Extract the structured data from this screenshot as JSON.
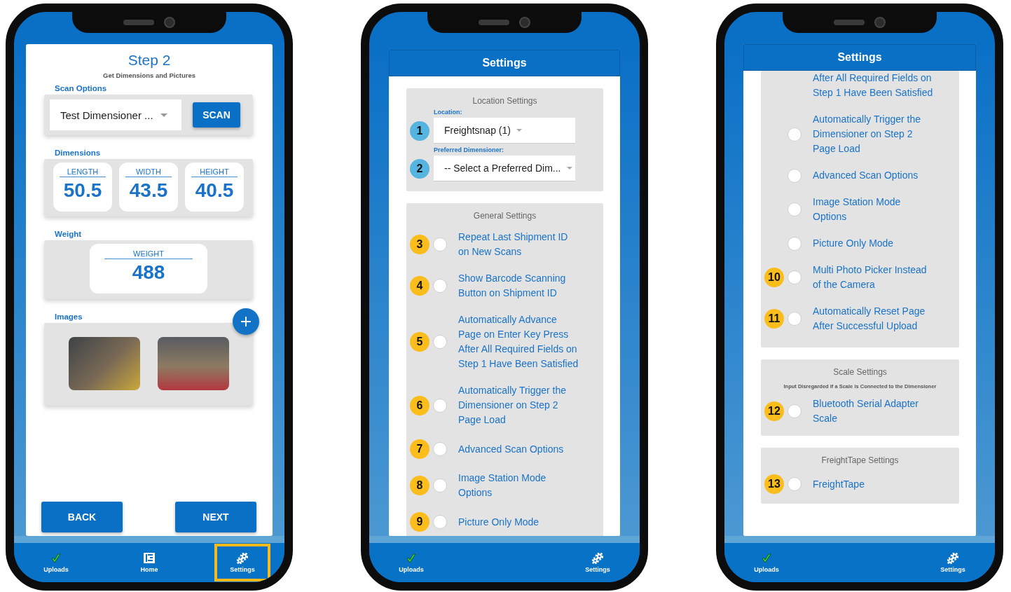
{
  "phones": [
    {
      "screen": {
        "kind": "step",
        "title": "Step 2",
        "subtitle": "Get Dimensions and Pictures",
        "scan_options": {
          "label": "Scan Options",
          "dropdown_value": "Test Dimensioner ...",
          "button": "SCAN"
        },
        "dimensions": {
          "label": "Dimensions",
          "fields": [
            {
              "label": "LENGTH",
              "value": "50.5"
            },
            {
              "label": "WIDTH",
              "value": "43.5"
            },
            {
              "label": "HEIGHT",
              "value": "40.5"
            }
          ]
        },
        "weight": {
          "label": "Weight",
          "field": {
            "label": "WEIGHT",
            "value": "488"
          }
        },
        "images": {
          "label": "Images",
          "photos": [
            {
              "kind": "photo"
            },
            {
              "kind": "photo"
            }
          ]
        },
        "buttons": [
          "BACK",
          "NEXT"
        ]
      },
      "nav": [
        {
          "kind": "uploads",
          "label": "Uploads",
          "highlighted": false
        },
        {
          "kind": "home",
          "label": "Home",
          "highlighted": false
        },
        {
          "kind": "settings",
          "label": "Settings",
          "highlighted": true
        }
      ]
    },
    {
      "screen": {
        "kind": "settings",
        "title": "Settings",
        "scrolled": false,
        "sections": [
          {
            "kind": "location",
            "heading": "Location Settings",
            "fields": [
              {
                "label": "Location:",
                "value": "Freightsnap (1)",
                "badge": {
                  "number": "1",
                  "color": "#56b4e0"
                }
              },
              {
                "label": "Preferred Dimensioner:",
                "value": "-- Select a Preferred Dim...",
                "badge": {
                  "number": "2",
                  "color": "#56b4e0"
                }
              }
            ]
          },
          {
            "kind": "toggles",
            "heading": "General Settings",
            "items": [
              {
                "text": "Repeat Last Shipment ID on New Scans",
                "checked": false,
                "badge": {
                  "number": "3",
                  "color": "#fbbd1c"
                }
              },
              {
                "text": "Show Barcode Scanning Button on Shipment ID",
                "checked": false,
                "badge": {
                  "number": "4",
                  "color": "#fbbd1c"
                }
              },
              {
                "text": "Automatically Advance Page on Enter Key Press After All Required Fields on Step 1 Have Been Satisfied",
                "checked": false,
                "badge": {
                  "number": "5",
                  "color": "#fbbd1c"
                }
              },
              {
                "text": "Automatically Trigger the Dimensioner on Step 2 Page Load",
                "checked": false,
                "badge": {
                  "number": "6",
                  "color": "#fbbd1c"
                }
              },
              {
                "text": "Advanced Scan Options",
                "checked": false,
                "badge": {
                  "number": "7",
                  "color": "#fbbd1c"
                }
              },
              {
                "text": "Image Station Mode Options",
                "checked": false,
                "badge": {
                  "number": "8",
                  "color": "#fbbd1c"
                }
              },
              {
                "text": "Picture Only Mode",
                "checked": false,
                "badge": {
                  "number": "9",
                  "color": "#fbbd1c"
                }
              }
            ]
          }
        ]
      },
      "nav": [
        {
          "kind": "uploads",
          "label": "Uploads",
          "highlighted": false
        },
        {
          "kind": "settings",
          "label": "Settings",
          "highlighted": false
        }
      ]
    },
    {
      "screen": {
        "kind": "settings",
        "title": "Settings",
        "scrolled": true,
        "sections": [
          {
            "kind": "toggles",
            "items": [
              {
                "text": "After All Required Fields on Step 1 Have Been Satisfied"
              },
              {
                "text": "Automatically Trigger the Dimensioner on Step 2 Page Load",
                "checked": false
              },
              {
                "text": "Advanced Scan Options",
                "checked": false
              },
              {
                "text": "Image Station Mode Options",
                "checked": false
              },
              {
                "text": "Picture Only Mode",
                "checked": false
              },
              {
                "text": "Multi Photo Picker Instead of the Camera",
                "checked": false,
                "badge": {
                  "number": "10",
                  "color": "#fbbd1c"
                }
              },
              {
                "text": "Automatically Reset Page After Successful Upload",
                "checked": false,
                "badge": {
                  "number": "11",
                  "color": "#fbbd1c"
                }
              }
            ]
          },
          {
            "kind": "toggles",
            "heading": "Scale Settings",
            "note": "Input Disregarded if a Scale is Connected to the Dimensioner",
            "items": [
              {
                "text": "Bluetooth Serial Adapter Scale",
                "checked": false,
                "badge": {
                  "number": "12",
                  "color": "#fbbd1c"
                }
              }
            ]
          },
          {
            "kind": "toggles",
            "heading": "FreightTape Settings",
            "items": [
              {
                "text": "FreightTape",
                "checked": false,
                "badge": {
                  "number": "13",
                  "color": "#fbbd1c"
                }
              }
            ]
          }
        ]
      },
      "nav": [
        {
          "kind": "uploads",
          "label": "Uploads",
          "highlighted": false
        },
        {
          "kind": "settings",
          "label": "Settings",
          "highlighted": false
        }
      ]
    }
  ]
}
